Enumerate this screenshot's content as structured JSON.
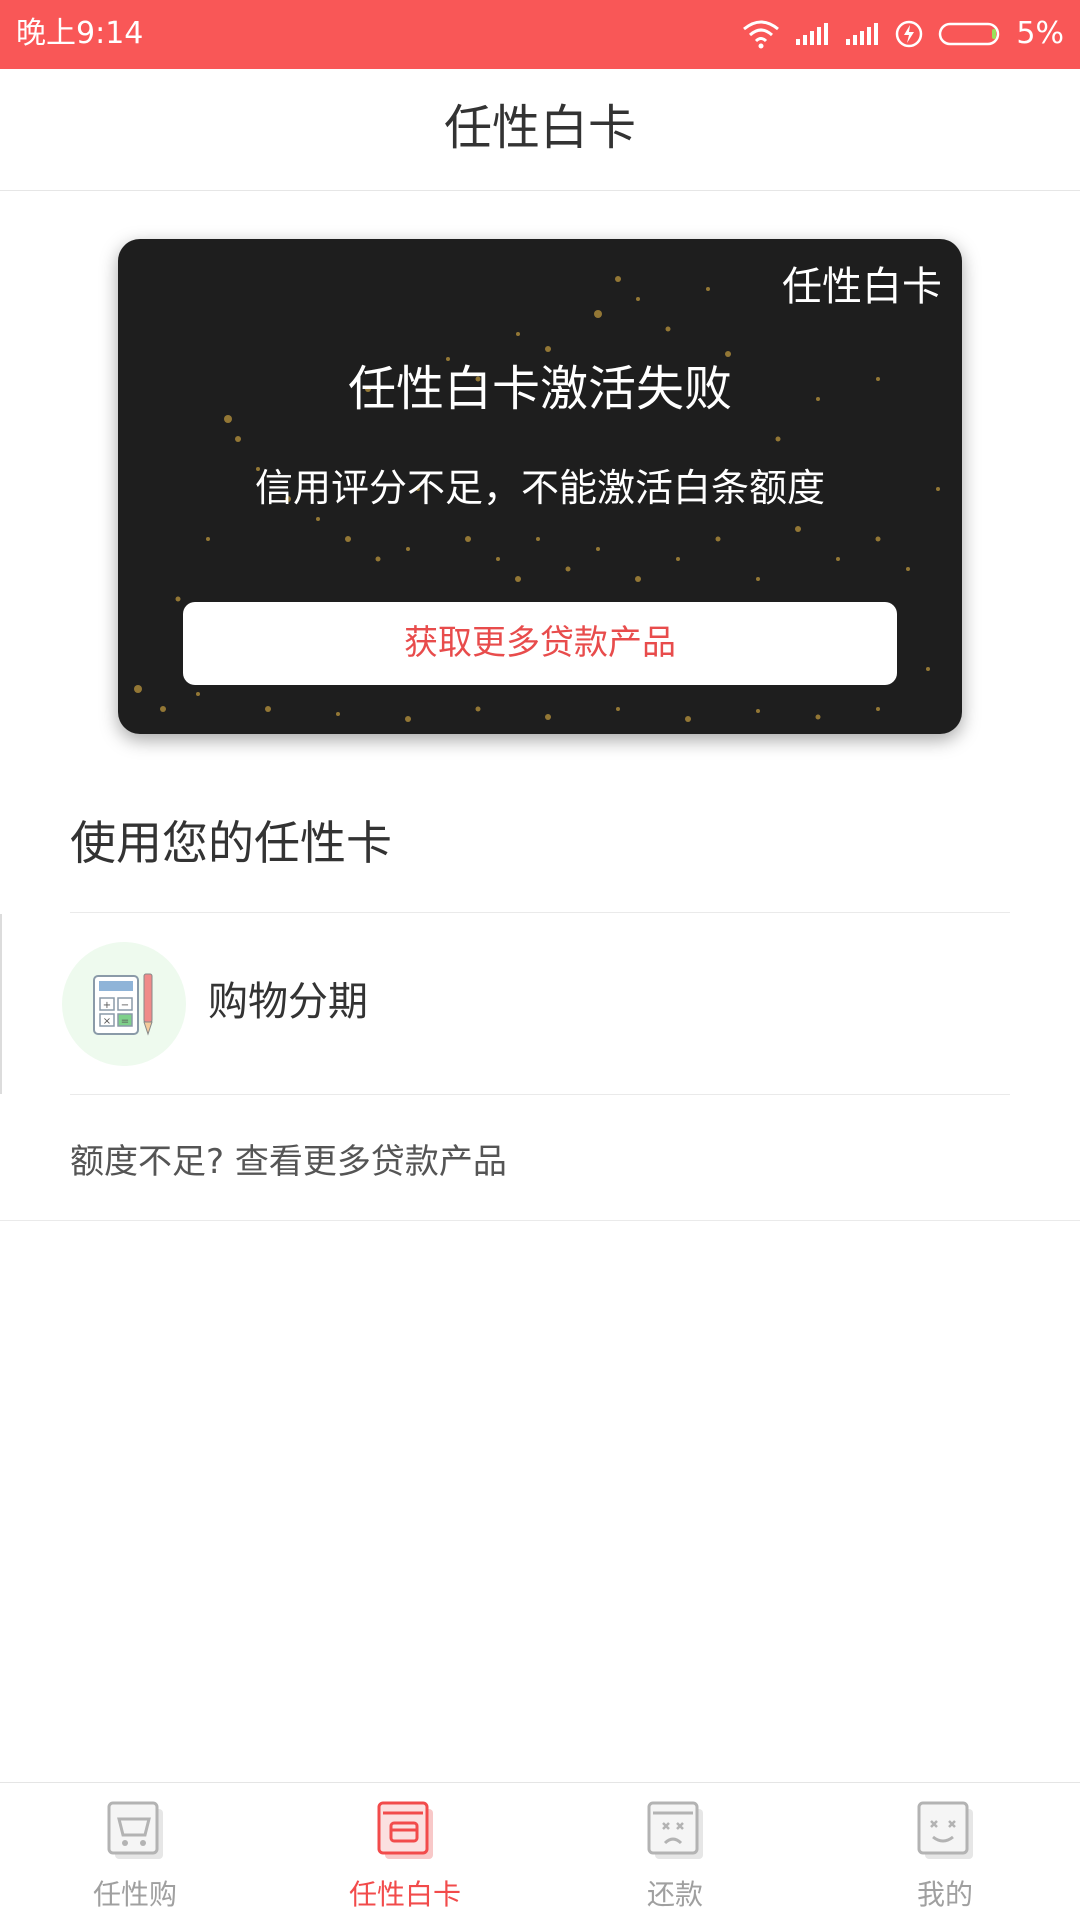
{
  "status_bar": {
    "time": "晚上9:14",
    "battery_text": "5%",
    "icons": [
      "wifi-icon",
      "signal-icon",
      "signal-icon",
      "charging-icon",
      "battery-icon"
    ]
  },
  "header": {
    "title": "任性白卡"
  },
  "card": {
    "brand": "任性白卡",
    "status_title": "任性白卡激活失败",
    "status_desc": "信用评分不足，不能激活白条额度",
    "button_label": "获取更多贷款产品",
    "colors": {
      "background": "#1e1e1e",
      "button_text": "#e84c4c"
    }
  },
  "section": {
    "title": "使用您的任性卡",
    "items": [
      {
        "label": "购物分期",
        "icon": "calculator-icon"
      }
    ],
    "more_link": "额度不足? 查看更多贷款产品"
  },
  "bottom_nav": {
    "tabs": [
      {
        "label": "任性购",
        "icon": "cart-icon",
        "active": false
      },
      {
        "label": "任性白卡",
        "icon": "card-icon",
        "active": true
      },
      {
        "label": "还款",
        "icon": "repay-icon",
        "active": false
      },
      {
        "label": "我的",
        "icon": "profile-icon",
        "active": false
      }
    ],
    "active_color": "#f24b4b",
    "inactive_color": "#a0a0a0"
  },
  "accent_color": "#f95757"
}
